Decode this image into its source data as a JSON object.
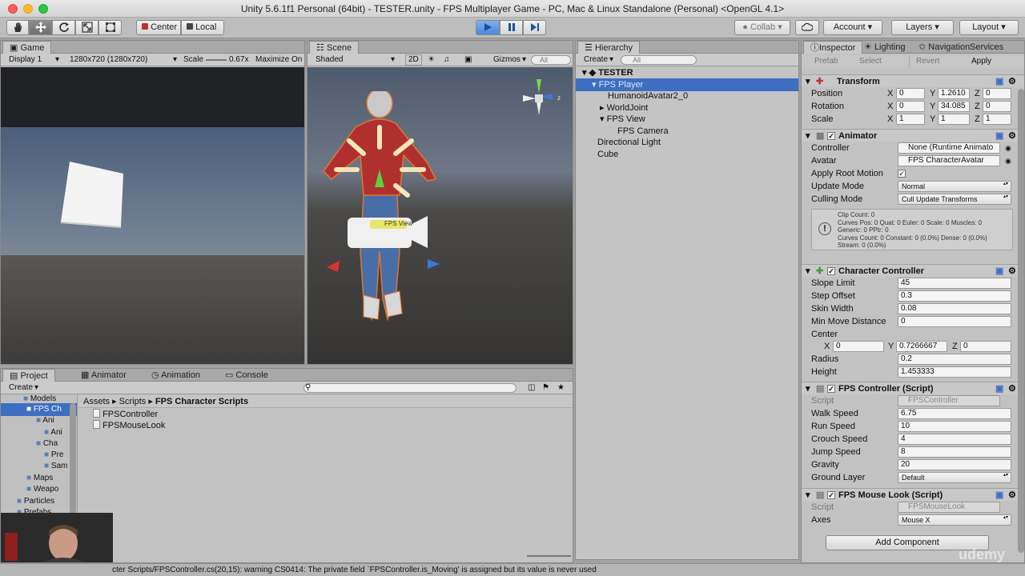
{
  "window": {
    "title": "Unity 5.6.1f1 Personal (64bit) - TESTER.unity - FPS Multiplayer Game - PC, Mac & Linux Standalone (Personal) <OpenGL 4.1>"
  },
  "toolbar": {
    "pivot": "Center",
    "space": "Local",
    "collab": "Collab",
    "account": "Account",
    "layers": "Layers",
    "layout": "Layout"
  },
  "game": {
    "tab": "Game",
    "display": "Display 1",
    "resolution": "1280x720 (1280x720)",
    "scale_label": "Scale",
    "scale_value": "0.67x",
    "maximize": "Maximize On P"
  },
  "scene": {
    "tab": "Scene",
    "shading": "Shaded",
    "mode2d": "2D",
    "gizmos": "Gizmos",
    "search": "All",
    "label": "FPS View"
  },
  "hierarchy": {
    "tab": "Hierarchy",
    "create": "Create",
    "search": "All",
    "scene": "TESTER",
    "items": [
      {
        "label": "FPS Player",
        "selected": true
      },
      {
        "label": "HumanoidAvatar2_0"
      },
      {
        "label": "WorldJoint"
      },
      {
        "label": "FPS View"
      },
      {
        "label": "FPS Camera"
      },
      {
        "label": "Directional Light"
      },
      {
        "label": "Cube"
      }
    ]
  },
  "project": {
    "tabs": [
      "Project",
      "Animator",
      "Animation",
      "Console"
    ],
    "create": "Create",
    "tree": [
      "Models",
      "FPS Ch",
      "Ani",
      "Ani",
      "Cha",
      "Pre",
      "Sam",
      "Maps",
      "Weapo",
      "Particles",
      "Prefabs"
    ],
    "breadcrumb": [
      "Assets",
      "Scripts",
      "FPS Character Scripts"
    ],
    "files": [
      "FPSController",
      "FPSMouseLook"
    ]
  },
  "status": {
    "message": "cter Scripts/FPSController.cs(20,15): warning CS0414: The private field `FPSController.is_Moving' is assigned but its value is never used"
  },
  "inspector": {
    "tabs": [
      "Inspector",
      "Lighting",
      "Navigation",
      "Services"
    ],
    "prefab_label": "Prefab",
    "select": "Select",
    "revert": "Revert",
    "apply": "Apply",
    "transform": {
      "title": "Transform",
      "position_label": "Position",
      "rotation_label": "Rotation",
      "scale_label": "Scale",
      "x": "X",
      "y": "Y",
      "z": "Z",
      "position": [
        "0",
        "1.2610",
        "0"
      ],
      "rotation": [
        "0",
        "34.085",
        "0"
      ],
      "scale": [
        "1",
        "1",
        "1"
      ]
    },
    "animator": {
      "title": "Animator",
      "controller_label": "Controller",
      "controller": "None (Runtime Animato",
      "avatar_label": "Avatar",
      "avatar": "FPS CharacterAvatar",
      "apply_root_label": "Apply Root Motion",
      "update_label": "Update Mode",
      "update": "Normal",
      "culling_label": "Culling Mode",
      "culling": "Cull Update Transforms",
      "info": [
        "Clip Count: 0",
        "Curves Pos: 0 Quat: 0 Euler: 0 Scale: 0 Muscles: 0",
        "Generic: 0 PPtr: 0",
        "Curves Count: 0 Constant: 0 (0.0%) Dense: 0 (0.0%)",
        "Stream: 0 (0.0%)"
      ]
    },
    "char_controller": {
      "title": "Character Controller",
      "fields": [
        {
          "label": "Slope Limit",
          "value": "45"
        },
        {
          "label": "Step Offset",
          "value": "0.3"
        },
        {
          "label": "Skin Width",
          "value": "0.08"
        },
        {
          "label": "Min Move Distance",
          "value": "0"
        }
      ],
      "center_label": "Center",
      "center": [
        "0",
        "0.7266667",
        "0"
      ],
      "radius_label": "Radius",
      "radius": "0.2",
      "height_label": "Height",
      "height": "1.453333"
    },
    "fps_controller": {
      "title": "FPS Controller (Script)",
      "script_label": "Script",
      "script": "FPSController",
      "fields": [
        {
          "label": "Walk Speed",
          "value": "6.75"
        },
        {
          "label": "Run Speed",
          "value": "10"
        },
        {
          "label": "Crouch Speed",
          "value": "4"
        },
        {
          "label": "Jump Speed",
          "value": "8"
        },
        {
          "label": "Gravity",
          "value": "20"
        }
      ],
      "ground_label": "Ground Layer",
      "ground": "Default"
    },
    "mouse_look": {
      "title": "FPS Mouse Look (Script)",
      "script_label": "Script",
      "script": "FPSMouseLook",
      "axes_label": "Axes",
      "axes": "Mouse X"
    },
    "add_component": "Add Component"
  },
  "watermark": "udemy",
  "colors": {
    "accent": "#3d7dd8",
    "selection": "#3d6ec2",
    "play": "#4a90e2"
  }
}
